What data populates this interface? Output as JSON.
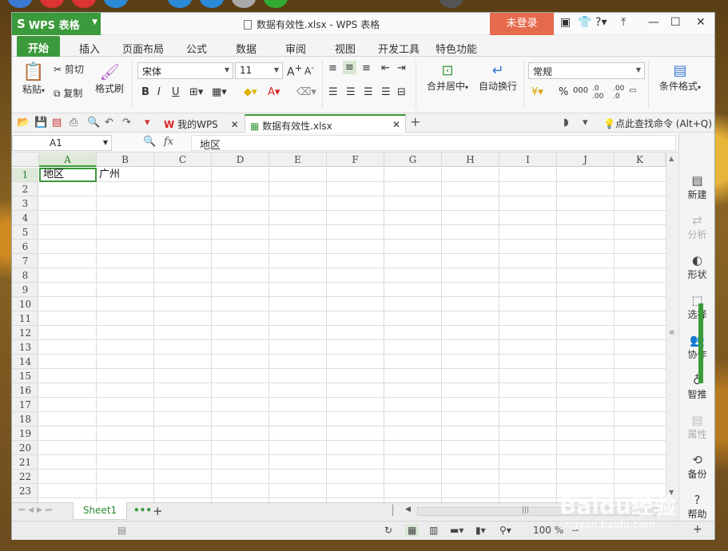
{
  "window": {
    "app_button": "WPS 表格",
    "title": "数据有效性.xlsx - WPS 表格",
    "login_button": "未登录",
    "help_label": "?"
  },
  "ribbon_tabs": [
    "开始",
    "插入",
    "页面布局",
    "公式",
    "数据",
    "审阅",
    "视图",
    "开发工具",
    "特色功能"
  ],
  "ribbon": {
    "paste": "粘贴",
    "cut": "剪切",
    "copy": "复制",
    "format_painter": "格式刷",
    "font_name": "宋体",
    "font_size": "11",
    "merge_center": "合并居中",
    "wrap_text": "自动换行",
    "number_format": "常规",
    "conditional_format": "条件格式",
    "percent": "%"
  },
  "doc_tabs": {
    "tab1": "我的WPS",
    "tab2": "数据有效性.xlsx",
    "search_hint": "点此查找命令 (Alt+Q)"
  },
  "formula_bar": {
    "name_box": "A1",
    "fx": "fx",
    "content": "地区"
  },
  "columns": [
    "A",
    "B",
    "C",
    "D",
    "E",
    "F",
    "G",
    "H",
    "I",
    "J",
    "K"
  ],
  "rows": [
    "1",
    "2",
    "3",
    "4",
    "5",
    "6",
    "7",
    "8",
    "9",
    "10",
    "11",
    "12",
    "13",
    "14",
    "15",
    "16",
    "17",
    "18",
    "19",
    "20",
    "21",
    "22",
    "23"
  ],
  "cells": {
    "A1": "地区",
    "B1": "广州"
  },
  "sheet": {
    "active_tab": "Sheet1",
    "zoom": "100 %"
  },
  "right_panel": [
    {
      "label": "新建",
      "enabled": true
    },
    {
      "label": "分析",
      "enabled": false
    },
    {
      "label": "形状",
      "enabled": true
    },
    {
      "label": "选择",
      "enabled": true
    },
    {
      "label": "协作",
      "enabled": true
    },
    {
      "label": "智推",
      "enabled": true
    },
    {
      "label": "属性",
      "enabled": false
    },
    {
      "label": "备份",
      "enabled": true
    },
    {
      "label": "帮助",
      "enabled": true
    }
  ],
  "watermark": {
    "logo": "Baidu经验",
    "url": "jingyan.baidu.com"
  },
  "colors": {
    "accent": "#3b9a3b",
    "login": "#e66a4c"
  }
}
